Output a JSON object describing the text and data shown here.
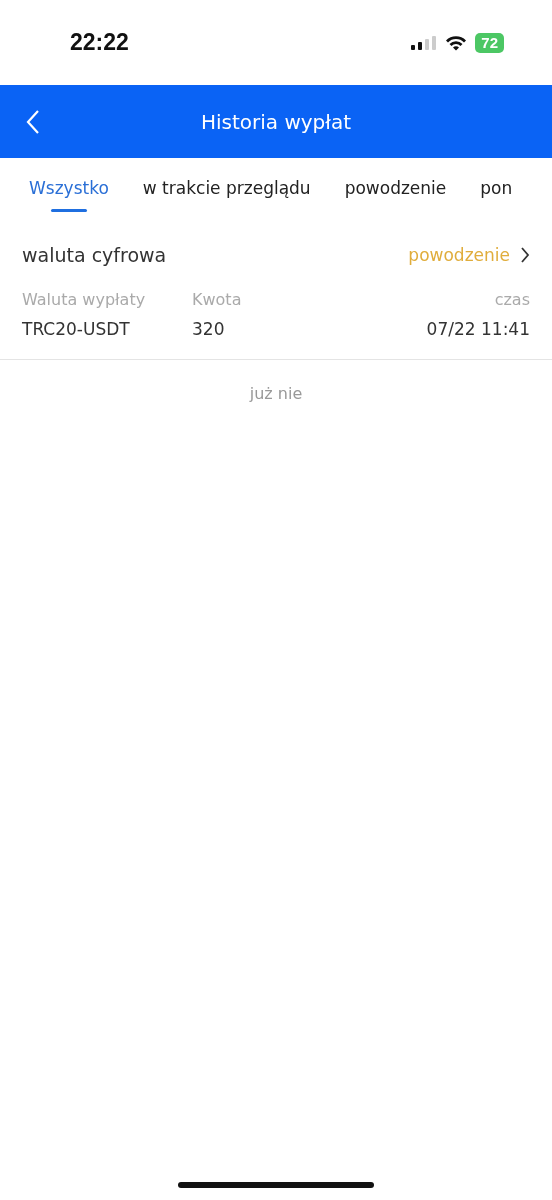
{
  "status_bar": {
    "time": "22:22",
    "battery": "72"
  },
  "header": {
    "title": "Historia wypłat"
  },
  "tabs": [
    {
      "label": "Wszystko",
      "selected": true
    },
    {
      "label": "w trakcie przeglądu",
      "selected": false
    },
    {
      "label": "powodzenie",
      "selected": false
    },
    {
      "label": "pon",
      "selected": false
    }
  ],
  "records": [
    {
      "type": "waluta cyfrowa",
      "status": "powodzenie",
      "columns": [
        {
          "heading": "Waluta wypłaty",
          "value": "TRC20-USDT"
        },
        {
          "heading": "Kwota",
          "value": "320"
        },
        {
          "heading": "czas",
          "value": "07/22 11:41"
        }
      ]
    }
  ],
  "end_message": "już nie"
}
